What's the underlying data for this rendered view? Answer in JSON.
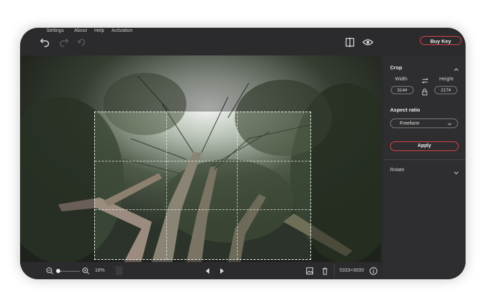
{
  "menu": {
    "settings": "Settings",
    "about": "About",
    "help": "Help",
    "activation": "Activation"
  },
  "toolbar": {
    "buy_label": "Buy Key",
    "icons": [
      "undo-icon",
      "redo-icon",
      "reset-icon",
      "compare-icon",
      "preview-eye-icon"
    ]
  },
  "crop_panel": {
    "title": "Crop",
    "width_label": "Width",
    "height_label": "Height",
    "width_value": "3144",
    "height_value": "2174",
    "aspect_title": "Aspect ratio",
    "aspect_value": "Freeform",
    "apply_label": "Apply",
    "rotate_label": "Rotate"
  },
  "bottom": {
    "zoom": "18%",
    "dimensions": "5333×3000"
  },
  "colors": {
    "accent": "#d8434b",
    "panel": "#2e2e30",
    "window": "#2b2b2d"
  }
}
